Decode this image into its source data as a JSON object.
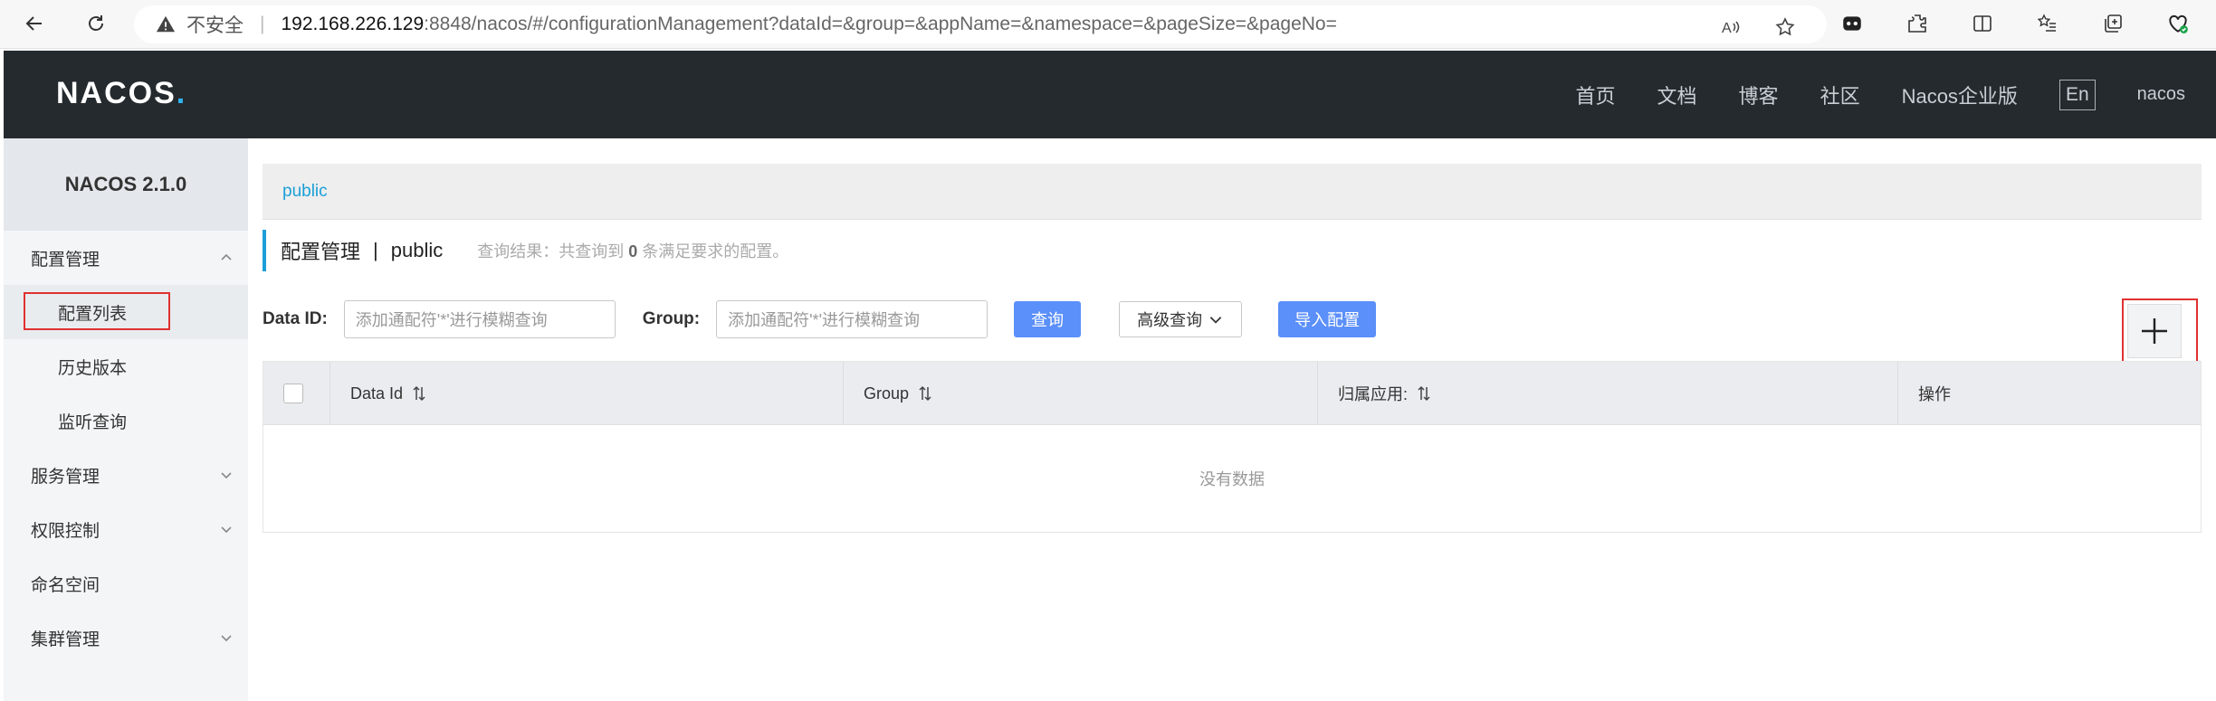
{
  "browser": {
    "insecure_label": "不安全",
    "url_host": "192.168.226.129",
    "url_path": ":8848/nacos/#/configurationManagement?dataId=&group=&appName=&namespace=&pageSize=&pageNo="
  },
  "header": {
    "logo": "NACOS",
    "nav": [
      "首页",
      "文档",
      "博客",
      "社区",
      "Nacos企业版"
    ],
    "lang": "En",
    "user": "nacos"
  },
  "sidebar": {
    "version": "NACOS 2.1.0",
    "items": [
      {
        "label": "配置管理"
      },
      {
        "label": "配置列表"
      },
      {
        "label": "历史版本"
      },
      {
        "label": "监听查询"
      },
      {
        "label": "服务管理"
      },
      {
        "label": "权限控制"
      },
      {
        "label": "命名空间"
      },
      {
        "label": "集群管理"
      }
    ]
  },
  "main": {
    "namespace_tab": "public",
    "title": "配置管理",
    "separator": "|",
    "namespace": "public",
    "result_prefix": "查询结果：共查询到",
    "result_count": "0",
    "result_suffix": "条满足要求的配置。",
    "filters": {
      "dataid_label": "Data ID:",
      "dataid_placeholder": "添加通配符'*'进行模糊查询",
      "group_label": "Group:",
      "group_placeholder": "添加通配符'*'进行模糊查询",
      "query_button": "查询",
      "advanced_button": "高级查询",
      "import_button": "导入配置"
    },
    "table": {
      "columns": [
        "Data Id",
        "Group",
        "归属应用:",
        "操作"
      ],
      "empty": "没有数据"
    }
  },
  "colors": {
    "accent": "#5b8ff9",
    "topbar": "#252a2f",
    "highlight": "#e03131"
  }
}
